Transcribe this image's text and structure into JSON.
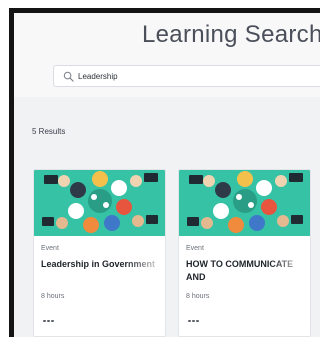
{
  "header": {
    "title": "Learning Search"
  },
  "search": {
    "value": "Leadership",
    "icon": "search-icon"
  },
  "results": {
    "count_label": "5 Results"
  },
  "cards": [
    {
      "type": "Event",
      "title": "Leadership in Government",
      "duration": "8 hours",
      "more_icon": "ellipsis-icon"
    },
    {
      "type": "Event",
      "title": "HOW TO COMMUNICATE AND",
      "duration": "8 hours",
      "more_icon": "ellipsis-icon"
    }
  ],
  "colors": {
    "thumbnail_background": "#35c2a5",
    "page_background": "#f1f2f4",
    "title_text": "#4a4f59"
  }
}
